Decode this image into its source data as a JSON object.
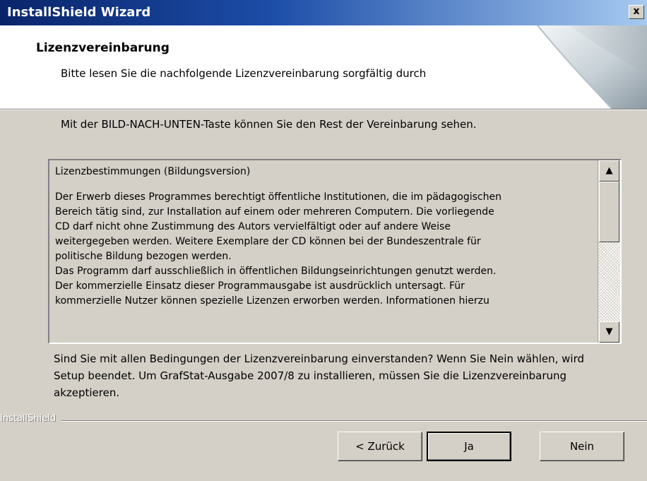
{
  "window": {
    "title": "InstallShield Wizard",
    "close_symbol": "x"
  },
  "header": {
    "title": "Lizenzvereinbarung",
    "subtitle": "Bitte lesen Sie die nachfolgende Lizenzvereinbarung sorgfältig durch"
  },
  "instruction": "Mit der BILD-NACH-UNTEN-Taste können Sie den Rest der Vereinbarung sehen.",
  "license": {
    "heading": "Lizenzbestimmungen (Bildungsversion)",
    "lines": [
      "Der Erwerb dieses Programmes berechtigt öffentliche Institutionen, die im pädagogischen",
      "Bereich tätig sind, zur Installation auf einem oder mehreren Computern. Die vorliegende",
      "CD darf nicht ohne Zustimmung des Autors vervielfältigt oder auf andere Weise",
      "weitergegeben werden. Weitere Exemplare der CD können bei der Bundeszentrale für",
      "politische Bildung bezogen werden.",
      "Das Programm darf ausschließlich in öffentlichen Bildungseinrichtungen genutzt werden.",
      "Der kommerzielle Einsatz dieser Programmausgabe ist ausdrücklich untersagt. Für",
      "kommerzielle Nutzer können spezielle Lizenzen erworben werden. Informationen hierzu"
    ],
    "scroll_up_icon": "▲",
    "scroll_down_icon": "▼"
  },
  "question": "Sind Sie mit allen Bedingungen der Lizenzvereinbarung einverstanden? Wenn Sie Nein wählen, wird Setup beendet. Um GrafStat-Ausgabe 2007/8 zu installieren, müssen Sie die Lizenzvereinbarung akzeptieren.",
  "brand": "InstallShield",
  "buttons": {
    "back": "< Zurück",
    "yes": "Ja",
    "no": "Nein"
  }
}
